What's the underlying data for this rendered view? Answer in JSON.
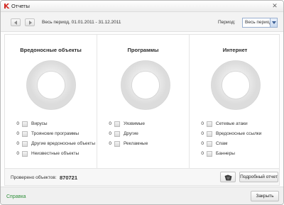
{
  "window": {
    "title": "Отчеты",
    "close_glyph": "✕"
  },
  "toolbar": {
    "period_text": "Весь период, 01.01.2011 - 31.12.2011",
    "period_label": "Период:",
    "period_value": "Весь период"
  },
  "columns": [
    {
      "title": "Вредоносные объекты",
      "items": [
        {
          "count": "0",
          "label": "Вирусы"
        },
        {
          "count": "0",
          "label": "Троянские программы"
        },
        {
          "count": "0",
          "label": "Другие вредоносные объекты"
        },
        {
          "count": "0",
          "label": "Неизвестные объекты"
        }
      ]
    },
    {
      "title": "Программы",
      "items": [
        {
          "count": "0",
          "label": "Уязвимые"
        },
        {
          "count": "0",
          "label": "Другие"
        },
        {
          "count": "0",
          "label": "Рекламные"
        }
      ]
    },
    {
      "title": "Интернет",
      "items": [
        {
          "count": "0",
          "label": "Сетевые атаки"
        },
        {
          "count": "0",
          "label": "Вредоносные ссылки"
        },
        {
          "count": "0",
          "label": "Спам"
        },
        {
          "count": "0",
          "label": "Баннеры"
        }
      ]
    }
  ],
  "summary": {
    "checked_label": "Проверено объектов:",
    "checked_value": "870721"
  },
  "buttons": {
    "detailed_report": "Подробный отчет",
    "close": "Закрыть"
  },
  "help": {
    "label": "Справка"
  },
  "colors": {
    "accent_red": "#d2261f",
    "link_green": "#2f8f3a",
    "select_border": "#9ab0d0"
  }
}
